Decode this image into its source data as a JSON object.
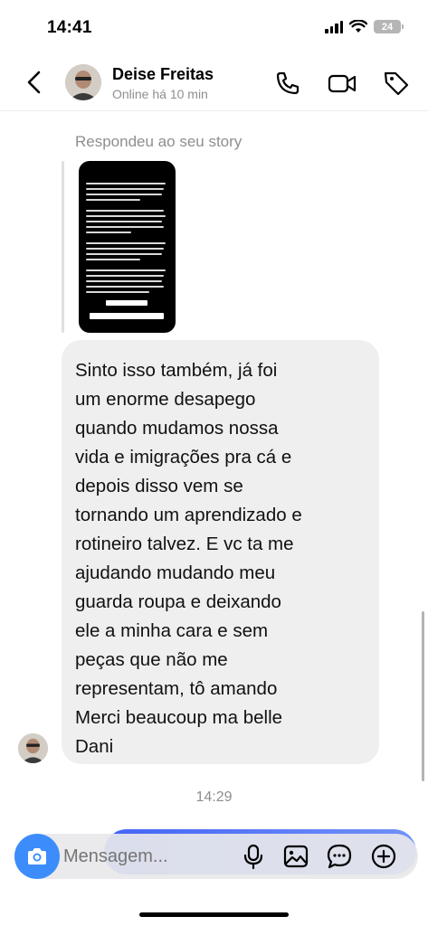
{
  "status_bar": {
    "time": "14:41",
    "battery": "24",
    "icons": [
      "signal-icon",
      "wifi-icon",
      "battery-icon"
    ]
  },
  "header": {
    "contact_name": "Deise Freitas",
    "contact_status": "Online há 10 min",
    "actions": [
      "phone-icon",
      "video-icon",
      "tag-icon"
    ]
  },
  "chat": {
    "story_reply_label": "Respondeu ao seu story",
    "message_text": "Sinto isso também, já foi\num enorme desapego\nquando mudamos nossa\nvida e imigrações pra cá e\ndepois disso vem se\ntornando um aprendizado e\nrotineiro talvez. E vc ta me\najudando mudando meu\nguarda roupa e deixando\nele a minha cara e sem\npeças que não me\nrepresentam,  tô amando\nMerci beaucoup ma belle\nDani",
    "time_divider": "14:29"
  },
  "composer": {
    "placeholder": "Mensagem...",
    "icons": [
      "camera-icon",
      "microphone-icon",
      "gallery-icon",
      "sticker-icon",
      "plus-icon"
    ]
  },
  "colors": {
    "accent": "#3c8dfb",
    "bubble": "#efefef",
    "muted": "#8e8e8e"
  }
}
